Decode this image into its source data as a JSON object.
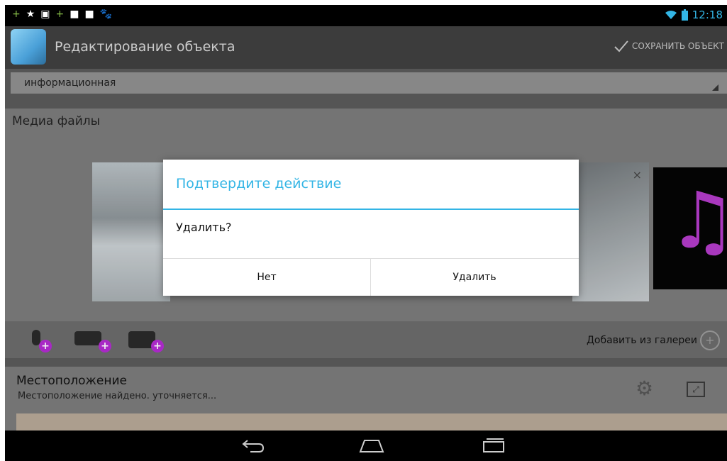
{
  "status_bar": {
    "icons_left": [
      "+",
      "★",
      "▣",
      "+",
      "■",
      "■",
      "🐾"
    ],
    "time": "12:18",
    "wifi_icon": "wifi-icon",
    "battery_icon": "battery-icon"
  },
  "action_bar": {
    "title": "Редактирование объекта",
    "save_label": "СОХРАНИТЬ ОБЪЕКТ"
  },
  "type_selector": {
    "value": "информационная"
  },
  "media": {
    "title": "Медиа файлы",
    "add_from_gallery": "Добавить из галереи"
  },
  "location": {
    "title": "Местоположение",
    "status": "Местоположение найдено. уточняется..."
  },
  "dialog": {
    "title": "Подтвердите действие",
    "message": "Удалить?",
    "buttons": {
      "no": "Нет",
      "delete": "Удалить"
    }
  },
  "colors": {
    "accent": "#33b5e5",
    "plus_badge": "#b22bd0"
  }
}
